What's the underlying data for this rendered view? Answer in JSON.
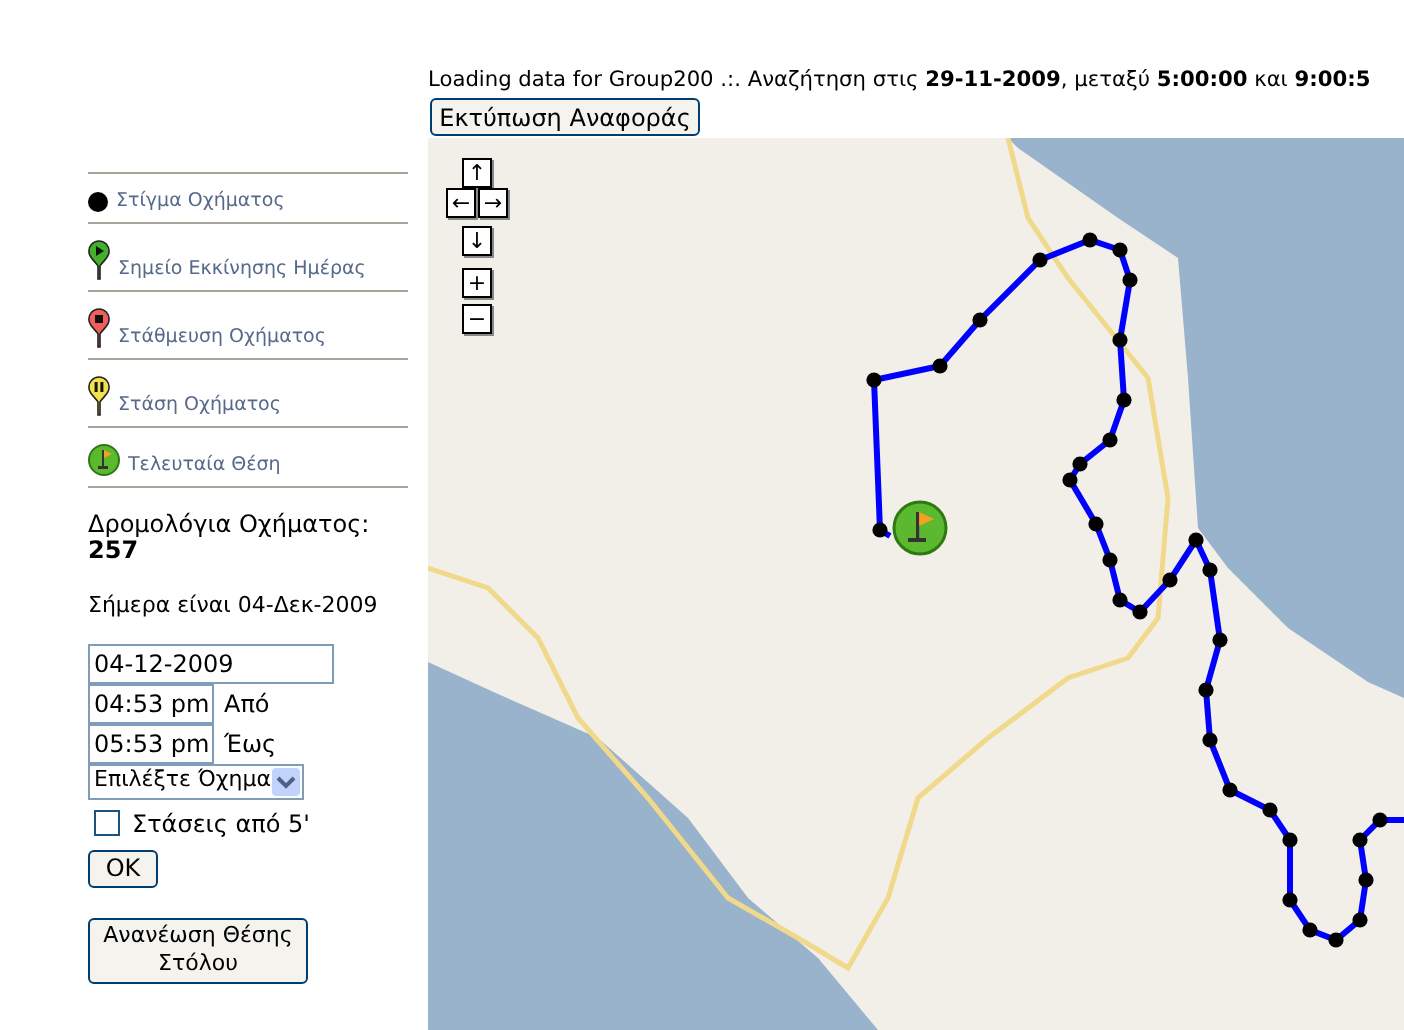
{
  "header": {
    "status": "Loading data for Group200 .:. Αναζήτηση στις **29-11-2009**, μεταξύ **5:00:00** και **9:00:5**",
    "print_button": "Εκτύπωση Αναφοράς"
  },
  "legend": [
    {
      "kind": "dot",
      "label": "Στίγμα Οχήματος"
    },
    {
      "kind": "start-pin",
      "label": "Σημείο Εκκίνησης Ημέρας"
    },
    {
      "kind": "parking-pin",
      "label": "Στάθμευση Οχήματος"
    },
    {
      "kind": "stop-pin",
      "label": "Στάση Οχήματος"
    },
    {
      "kind": "last-position",
      "label": "Τελευταία Θέση"
    }
  ],
  "routes": {
    "label": "Δρομολόγια Οχήματος:",
    "count": "257"
  },
  "today": "Σήμερα είναι 04-Δεκ-2009",
  "form": {
    "date": "04-12-2009",
    "from_time": "04:53 pm",
    "from_label": "Από",
    "to_time": "05:53 pm",
    "to_label": "Έως",
    "vehicle_select": "Επιλέξτε Όχημα",
    "stops_checkbox": {
      "label": "Στάσεις από 5'",
      "checked": false
    },
    "ok_button": "OK"
  },
  "refresh_button": "Ανανέωση Θέσης Στόλου",
  "map": {
    "pan_controls": [
      "↑",
      "←",
      "→",
      "↓"
    ],
    "zoom_controls": [
      "+",
      "−"
    ]
  }
}
